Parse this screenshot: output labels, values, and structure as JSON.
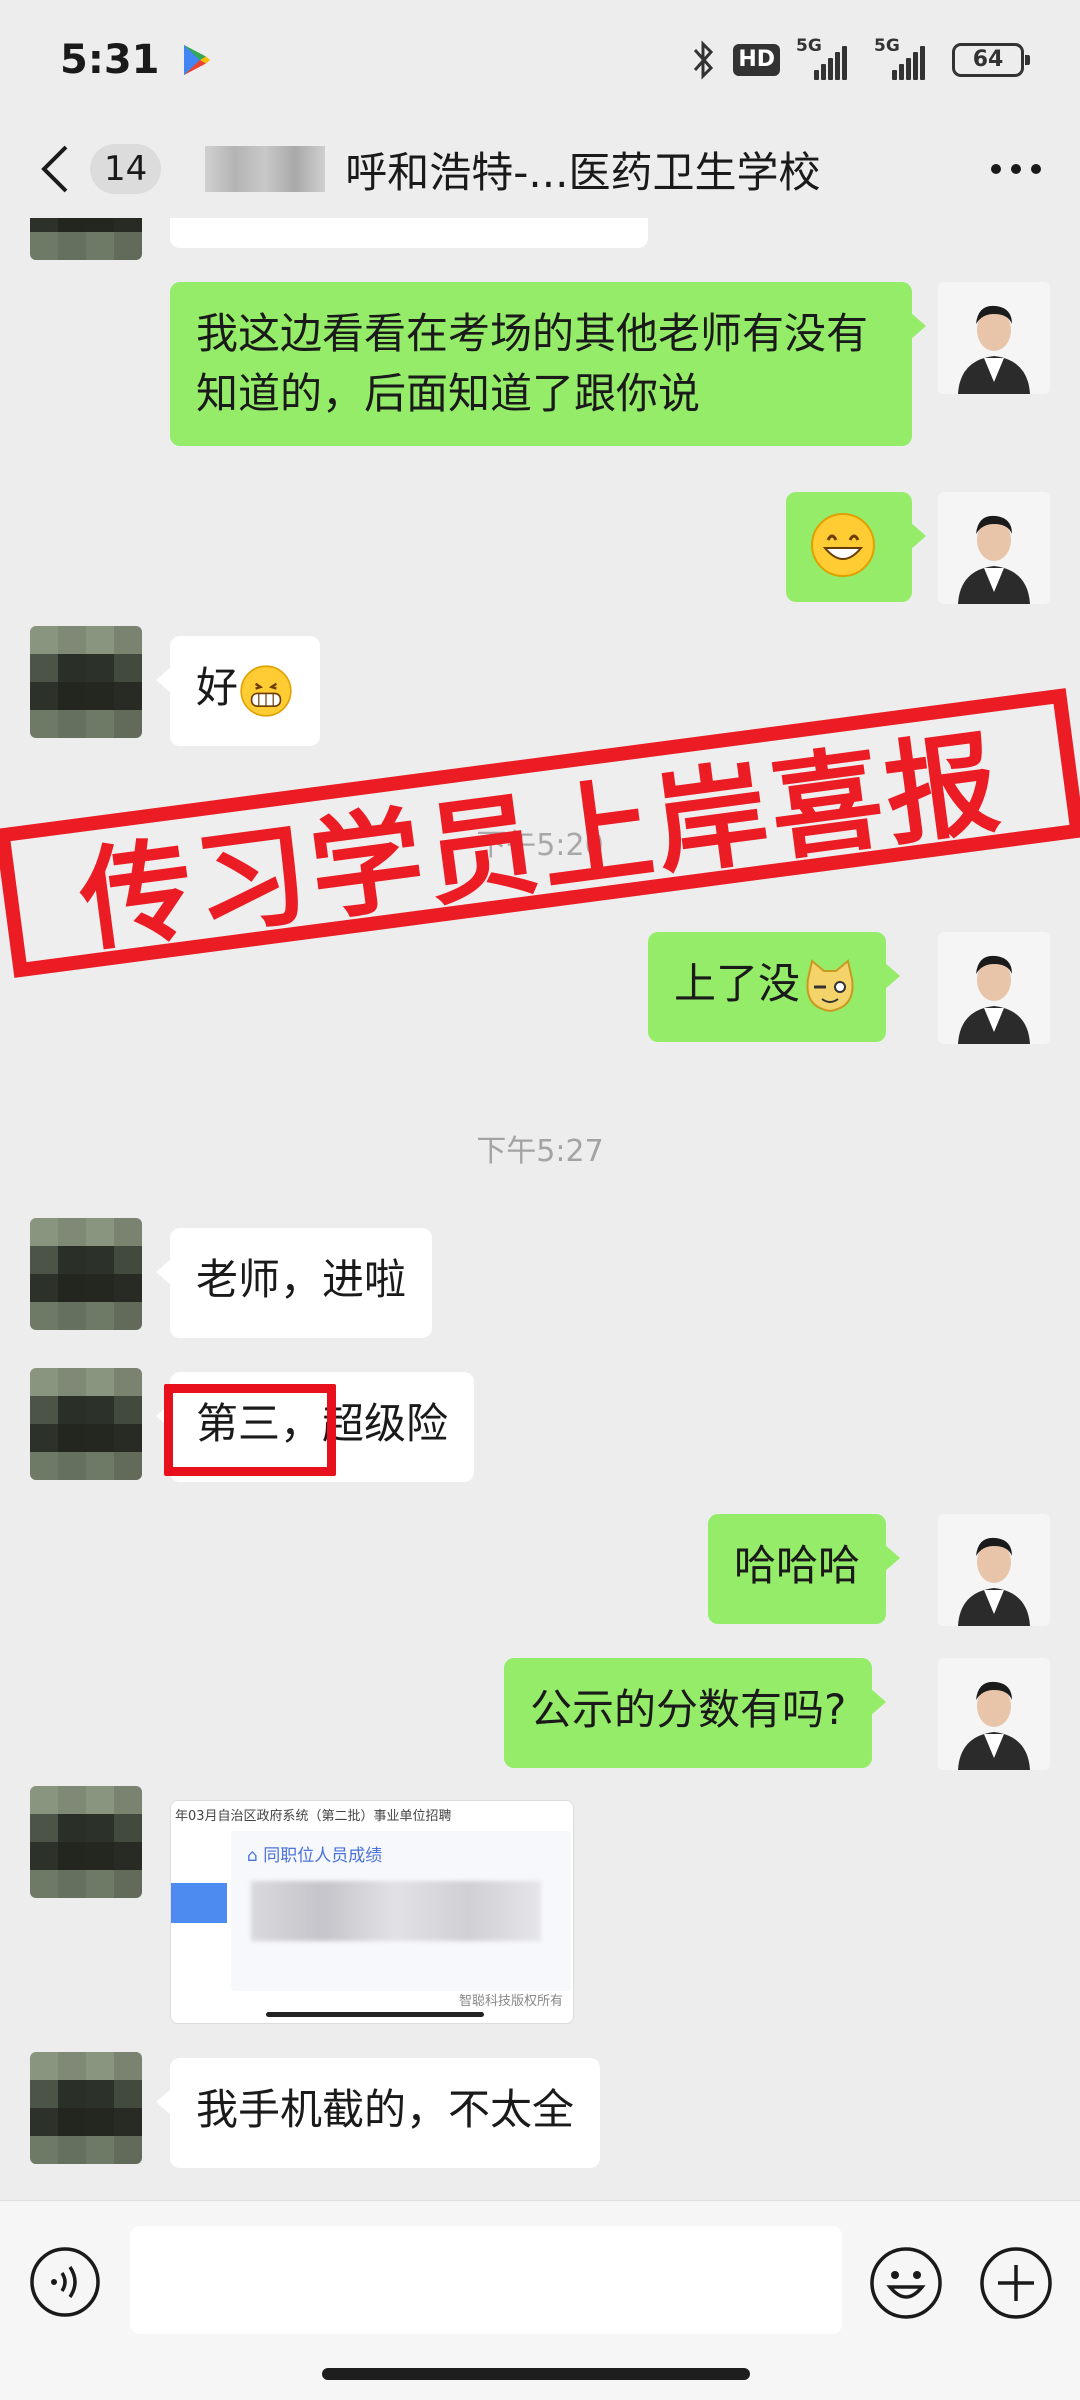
{
  "status_bar": {
    "time": "5:31",
    "hd_label": "HD",
    "network_1": "5G",
    "network_2": "5G",
    "battery": "64"
  },
  "header": {
    "unread_count": "14",
    "title": "呼和浩特-...医药卫生学校",
    "more_icon": "more-dots-icon",
    "back_icon": "chevron-left-icon"
  },
  "messages": [
    {
      "side": "out",
      "text": "我这边看看在考场的其他老师有没有知道的，后面知道了跟你说"
    },
    {
      "side": "out",
      "emoji": "grinning-face-emoji"
    },
    {
      "side": "in",
      "text": "好"
    },
    {
      "timestamp": "下午5:20"
    },
    {
      "side": "out",
      "text": "上了没"
    },
    {
      "timestamp": "下午5:27"
    },
    {
      "side": "in",
      "text": "老师，进啦"
    },
    {
      "side": "in",
      "text": "第三，超级险"
    },
    {
      "side": "out",
      "text": "哈哈哈"
    },
    {
      "side": "out",
      "text": "公示的分数有吗?"
    },
    {
      "side": "in",
      "image": {
        "caption": "年03月自治区政府系统（第二批）事业单位招聘",
        "subtitle": "同职位人员成绩",
        "footer": "智聪科技版权所有"
      }
    },
    {
      "side": "in",
      "text": "我手机截的，不太全"
    }
  ],
  "stamp": {
    "text": "传习学员上岸喜报",
    "color": "#ec1c24"
  },
  "input": {
    "value": "",
    "placeholder": ""
  },
  "colors": {
    "background": "#ededed",
    "outgoing_bubble": "#95ec69",
    "incoming_bubble": "#ffffff",
    "highlight": "#e8101c"
  }
}
